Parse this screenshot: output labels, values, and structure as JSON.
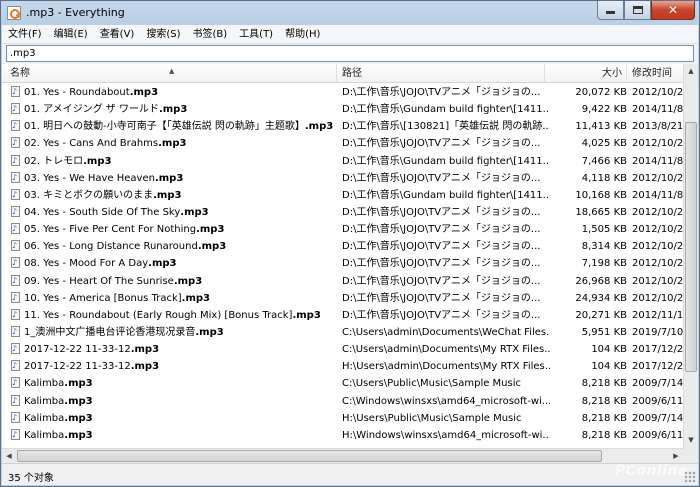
{
  "window": {
    "title": ".mp3 - Everything"
  },
  "menu": [
    "文件(F)",
    "编辑(E)",
    "查看(V)",
    "搜索(S)",
    "书签(B)",
    "工具(T)",
    "帮助(H)"
  ],
  "search": {
    "value": ".mp3"
  },
  "columns": {
    "name": "名称",
    "path": "路径",
    "size": "大小",
    "modified": "修改时间"
  },
  "rows": [
    {
      "name_pre": "01. Yes - Roundabout",
      "ext": ".mp3",
      "path": "D:\\工作\\音乐\\JOJO\\TVアニメ「ジョジョの...",
      "size": "20,072 KB",
      "date": "2012/10/2"
    },
    {
      "name_pre": "01. アメイジング ザ ワールド",
      "ext": ".mp3",
      "path": "D:\\工作\\音乐\\Gundam build fighter\\[1411...",
      "size": "9,422 KB",
      "date": "2014/11/8"
    },
    {
      "name_pre": "01. 明日への鼓動-小寺可南子【「英雄伝説 閃の軌跡」主题歌】",
      "ext": ".mp3",
      "path": "D:\\工作\\音乐\\[130821]「英雄伝説 閃の軌跡...",
      "size": "11,413 KB",
      "date": "2013/8/21"
    },
    {
      "name_pre": "02. Yes - Cans And Brahms",
      "ext": ".mp3",
      "path": "D:\\工作\\音乐\\JOJO\\TVアニメ「ジョジョの...",
      "size": "4,025 KB",
      "date": "2012/10/2"
    },
    {
      "name_pre": "02. トレモロ",
      "ext": ".mp3",
      "path": "D:\\工作\\音乐\\Gundam build fighter\\[1411...",
      "size": "7,466 KB",
      "date": "2014/11/8"
    },
    {
      "name_pre": "03. Yes - We Have Heaven",
      "ext": ".mp3",
      "path": "D:\\工作\\音乐\\JOJO\\TVアニメ「ジョジョの...",
      "size": "4,118 KB",
      "date": "2012/10/2"
    },
    {
      "name_pre": "03. キミとボクの願いのまま",
      "ext": ".mp3",
      "path": "D:\\工作\\音乐\\Gundam build fighter\\[1411...",
      "size": "10,168 KB",
      "date": "2014/11/8"
    },
    {
      "name_pre": "04. Yes - South Side Of The Sky",
      "ext": ".mp3",
      "path": "D:\\工作\\音乐\\JOJO\\TVアニメ「ジョジョの...",
      "size": "18,665 KB",
      "date": "2012/10/2"
    },
    {
      "name_pre": "05. Yes - Five Per Cent For Nothing",
      "ext": ".mp3",
      "path": "D:\\工作\\音乐\\JOJO\\TVアニメ「ジョジョの...",
      "size": "1,505 KB",
      "date": "2012/10/2"
    },
    {
      "name_pre": "06. Yes - Long Distance Runaround",
      "ext": ".mp3",
      "path": "D:\\工作\\音乐\\JOJO\\TVアニメ「ジョジョの...",
      "size": "8,314 KB",
      "date": "2012/10/2"
    },
    {
      "name_pre": "08. Yes - Mood For A Day",
      "ext": ".mp3",
      "path": "D:\\工作\\音乐\\JOJO\\TVアニメ「ジョジョの...",
      "size": "7,198 KB",
      "date": "2012/10/2"
    },
    {
      "name_pre": "09. Yes - Heart Of The Sunrise",
      "ext": ".mp3",
      "path": "D:\\工作\\音乐\\JOJO\\TVアニメ「ジョジョの...",
      "size": "26,968 KB",
      "date": "2012/10/2"
    },
    {
      "name_pre": "10. Yes - America [Bonus Track]",
      "ext": ".mp3",
      "path": "D:\\工作\\音乐\\JOJO\\TVアニメ「ジョジョの...",
      "size": "24,934 KB",
      "date": "2012/10/2"
    },
    {
      "name_pre": "11. Yes - Roundabout (Early Rough Mix) [Bonus Track]",
      "ext": ".mp3",
      "path": "D:\\工作\\音乐\\JOJO\\TVアニメ「ジョジョの...",
      "size": "20,271 KB",
      "date": "2012/11/1"
    },
    {
      "name_pre": "1_澳洲中文广播电台评论香港现况录音",
      "ext": ".mp3",
      "path": "C:\\Users\\admin\\Documents\\WeChat Files...",
      "size": "5,951 KB",
      "date": "2019/7/10"
    },
    {
      "name_pre": "2017-12-22 11-33-12",
      "ext": ".mp3",
      "path": "C:\\Users\\admin\\Documents\\My RTX Files...",
      "size": "104 KB",
      "date": "2017/12/2"
    },
    {
      "name_pre": "2017-12-22 11-33-12",
      "ext": ".mp3",
      "path": "H:\\Users\\admin\\Documents\\My RTX Files...",
      "size": "104 KB",
      "date": "2017/12/2"
    },
    {
      "name_pre": "Kalimba",
      "ext": ".mp3",
      "path": "C:\\Users\\Public\\Music\\Sample Music",
      "size": "8,218 KB",
      "date": "2009/7/14"
    },
    {
      "name_pre": "Kalimba",
      "ext": ".mp3",
      "path": "C:\\Windows\\winsxs\\amd64_microsoft-wi...",
      "size": "8,218 KB",
      "date": "2009/6/11"
    },
    {
      "name_pre": "Kalimba",
      "ext": ".mp3",
      "path": "H:\\Users\\Public\\Music\\Sample Music",
      "size": "8,218 KB",
      "date": "2009/7/14"
    },
    {
      "name_pre": "Kalimba",
      "ext": ".mp3",
      "path": "H:\\Windows\\winsxs\\amd64_microsoft-wi...",
      "size": "8,218 KB",
      "date": "2009/6/11"
    }
  ],
  "status": {
    "text": "35 个对象"
  },
  "watermark": "PConline"
}
